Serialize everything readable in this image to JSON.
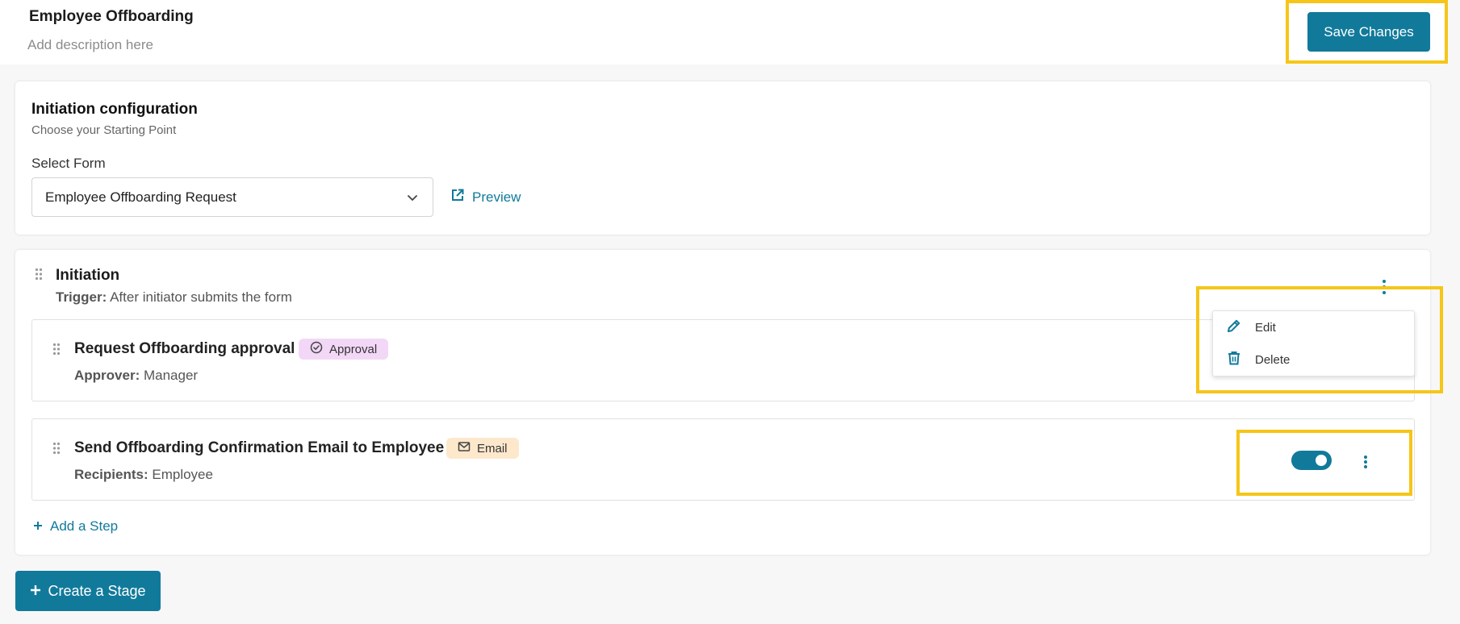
{
  "header": {
    "title": "Employee Offboarding",
    "description_placeholder": "Add description here",
    "save_label": "Save Changes"
  },
  "initiation_config": {
    "title": "Initiation configuration",
    "subtitle": "Choose your Starting Point",
    "select_label": "Select Form",
    "selected_form": "Employee Offboarding Request",
    "preview_label": "Preview"
  },
  "stage": {
    "title": "Initiation",
    "trigger_label": "Trigger:",
    "trigger_value": "After initiator submits the form",
    "steps": [
      {
        "title": "Request Offboarding approval",
        "badge": "Approval",
        "meta_label": "Approver:",
        "meta_value": "Manager"
      },
      {
        "title": "Send Offboarding Confirmation Email to Employee",
        "badge": "Email",
        "meta_label": "Recipients:",
        "meta_value": "Employee",
        "enabled": true
      }
    ],
    "add_step_label": "Add a Step"
  },
  "context_menu": {
    "edit_label": "Edit",
    "delete_label": "Delete"
  },
  "footer": {
    "create_stage_label": "Create a Stage"
  },
  "colors": {
    "primary": "#117a9b",
    "highlight": "#f6c518",
    "approval_badge_bg": "#f3d7f7",
    "email_badge_bg": "#fde8cc"
  },
  "icons": {
    "select_caret": "chevron-down-icon",
    "preview": "external-link-icon",
    "drag": "drag-handle-icon",
    "more": "more-vertical-icon",
    "approval": "check-circle-icon",
    "email": "mail-icon",
    "add": "plus-icon",
    "edit": "pencil-icon",
    "delete": "trash-icon"
  }
}
